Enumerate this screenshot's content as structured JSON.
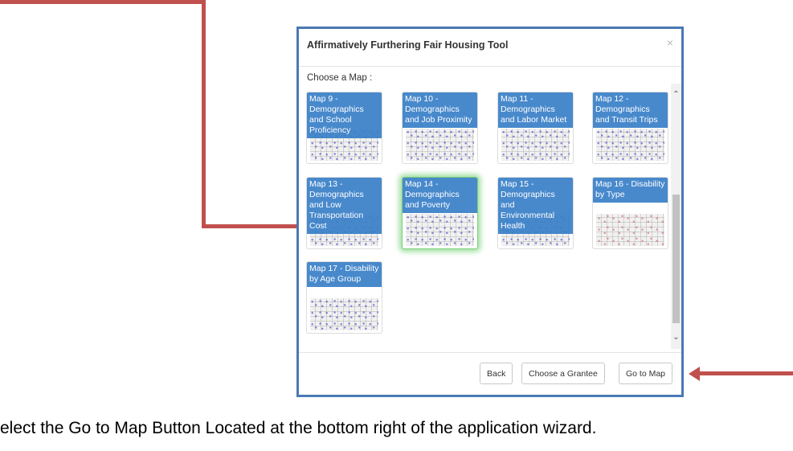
{
  "dialog": {
    "title": "Affirmatively Furthering Fair Housing Tool",
    "close_glyph": "×",
    "choose_label": "Choose a Map :"
  },
  "maps": [
    {
      "label": "Map 9 - Demographics and School Proficiency",
      "thumb": "blue-dots"
    },
    {
      "label": "Map 10 - Demographics and Job Proximity",
      "thumb": "blue-dots"
    },
    {
      "label": "Map 11 - Demographics and Labor Market",
      "thumb": "blue-dots"
    },
    {
      "label": "Map 12 - Demographics and Transit Trips",
      "thumb": "blue-dots"
    },
    {
      "label": "Map 13 - Demographics and Low Transportation Cost",
      "thumb": "blue-dots"
    },
    {
      "label": "Map 14 - Demographics and Poverty",
      "thumb": "blue-dots",
      "selected": true
    },
    {
      "label": "Map 15 - Demographics and Environmental Health",
      "thumb": "blue-dots"
    },
    {
      "label": "Map 16 - Disability by Type",
      "thumb": "pink-dots"
    },
    {
      "label": "Map 17 - Disability by Age Group",
      "thumb": "blue-dots"
    }
  ],
  "scrollbar": {
    "up_glyph": "⌃",
    "down_glyph": "⌄"
  },
  "footer": {
    "back_label": "Back",
    "choose_grantee_label": "Choose a Grantee",
    "go_to_map_label": "Go to Map"
  },
  "caption": "elect the Go to Map Button Located at the bottom right of the application wizard.",
  "colors": {
    "modal_border": "#4a79b5",
    "tile_label_bg": "#3a80c8",
    "selected_glow": "#78d278",
    "callout_arrow": "#c0504d"
  }
}
